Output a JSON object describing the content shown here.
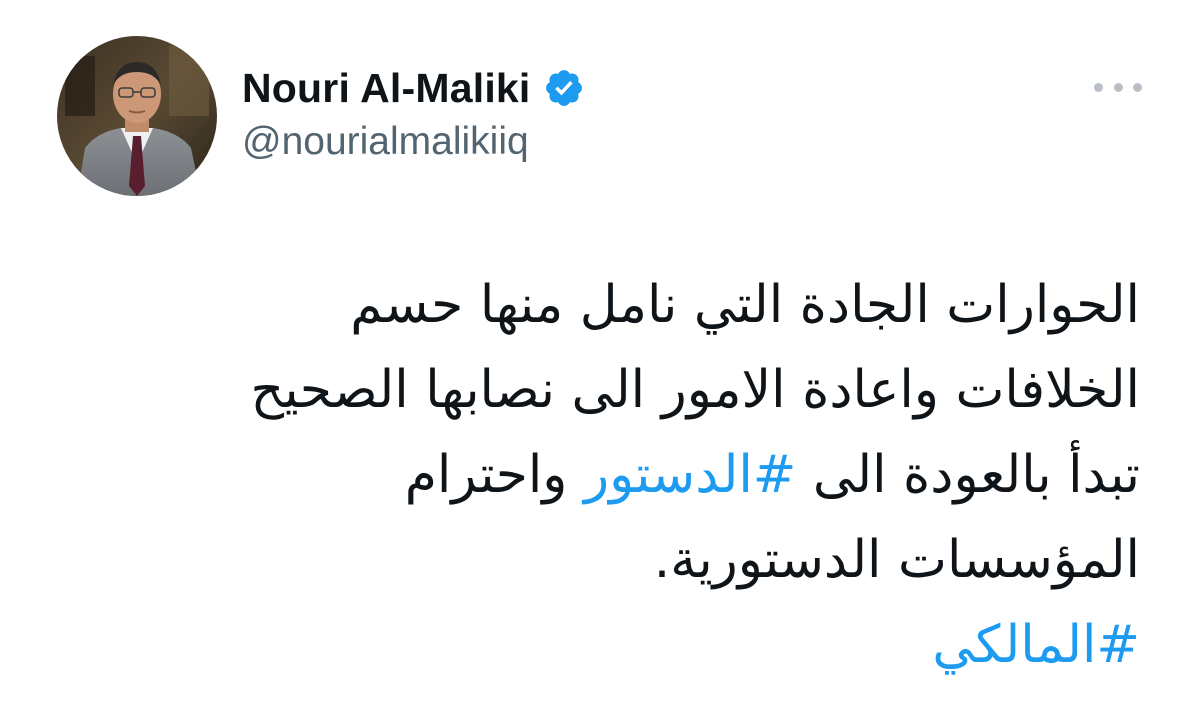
{
  "author": {
    "display_name": "Nouri Al-Maliki",
    "handle": "@nourialmalikiiq",
    "verified": true,
    "avatar_icon": "profile-photo"
  },
  "menu": {
    "icon": "more-horizontal-icon"
  },
  "tweet": {
    "line1": "الحوارات الجادة التي نامل منها حسم",
    "line2": "الخلافات واعادة الامور الى نصابها الصحيح",
    "line3_before": "تبدأ بالعودة الى ",
    "line3_hashtag": "#الدستور",
    "line3_after": " واحترام",
    "line4": "المؤسسات الدستورية.",
    "line5_hashtag": "#المالكي"
  },
  "colors": {
    "text": "#0f1419",
    "secondary": "#536471",
    "link": "#1d9bf0",
    "verified": "#1d9bf0"
  }
}
